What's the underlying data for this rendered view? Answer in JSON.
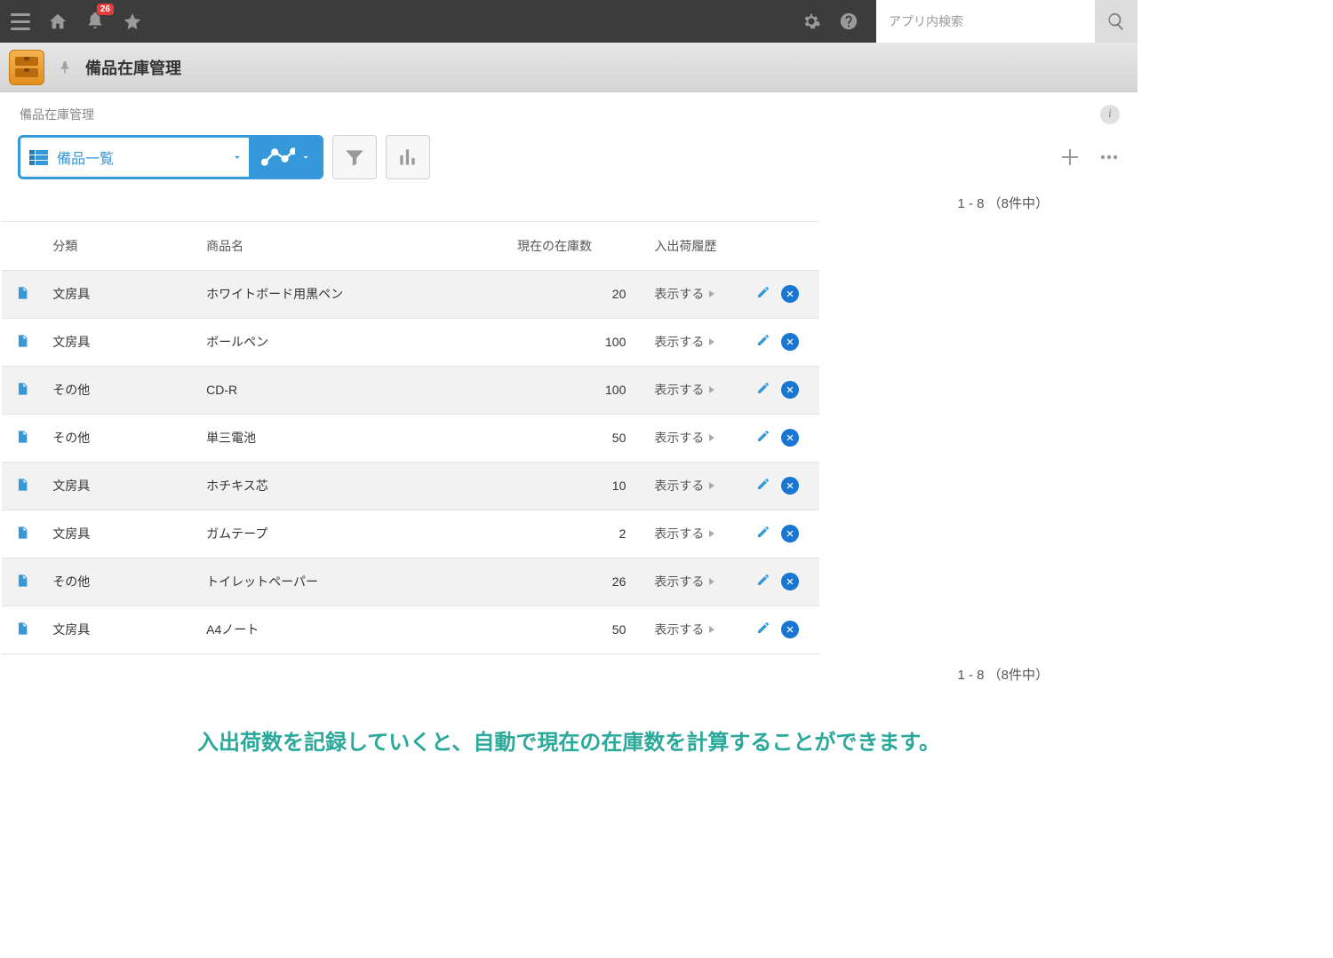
{
  "topbar": {
    "notification_count": "26",
    "search_placeholder": "アプリ内検索"
  },
  "apptitle": {
    "title": "備品在庫管理"
  },
  "breadcrumb": {
    "text": "備品在庫管理"
  },
  "toolbar": {
    "view_label": "備品一覧"
  },
  "pager": {
    "text_top": "1 - 8 （8件中）",
    "text_bottom": "1 - 8 （8件中）"
  },
  "table": {
    "headers": {
      "category": "分類",
      "name": "商品名",
      "stock": "現在の在庫数",
      "history": "入出荷履歴"
    },
    "show_label": "表示する",
    "rows": [
      {
        "category": "文房具",
        "name": "ホワイトボード用黒ペン",
        "stock": "20"
      },
      {
        "category": "文房具",
        "name": "ボールペン",
        "stock": "100"
      },
      {
        "category": "その他",
        "name": "CD-R",
        "stock": "100"
      },
      {
        "category": "その他",
        "name": "単三電池",
        "stock": "50"
      },
      {
        "category": "文房具",
        "name": "ホチキス芯",
        "stock": "10"
      },
      {
        "category": "文房具",
        "name": "ガムテープ",
        "stock": "2"
      },
      {
        "category": "その他",
        "name": "トイレットペーパー",
        "stock": "26"
      },
      {
        "category": "文房具",
        "name": "A4ノート",
        "stock": "50"
      }
    ]
  },
  "bottom_message": "入出荷数を記録していくと、自動で現在の在庫数を計算することができます。"
}
